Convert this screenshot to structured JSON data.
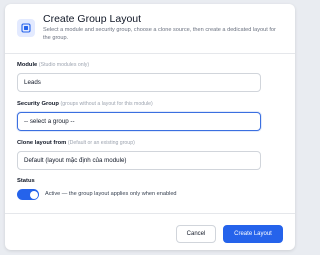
{
  "dialog": {
    "title": "Create Group Layout",
    "subtitle": "Select a module and security group, choose a clone source, then create a dedicated layout for the group.",
    "header_icon": "layout-icon",
    "accent_color": "#2563eb"
  },
  "fields": {
    "module": {
      "label": "Module",
      "hint": "(Studio modules only)",
      "value": "Leads"
    },
    "security_group": {
      "label": "Security Group",
      "hint": "(groups without a layout for this module)",
      "value": "-- select a group --"
    },
    "clone_from": {
      "label": "Clone layout from",
      "hint": "(Default or an existing group)",
      "value": "Default (layout mặc định của module)"
    },
    "status": {
      "label": "Status",
      "toggle_text": "Active — the group layout applies only when enabled",
      "enabled": true
    }
  },
  "buttons": {
    "cancel": "Cancel",
    "create": "Create Layout"
  }
}
